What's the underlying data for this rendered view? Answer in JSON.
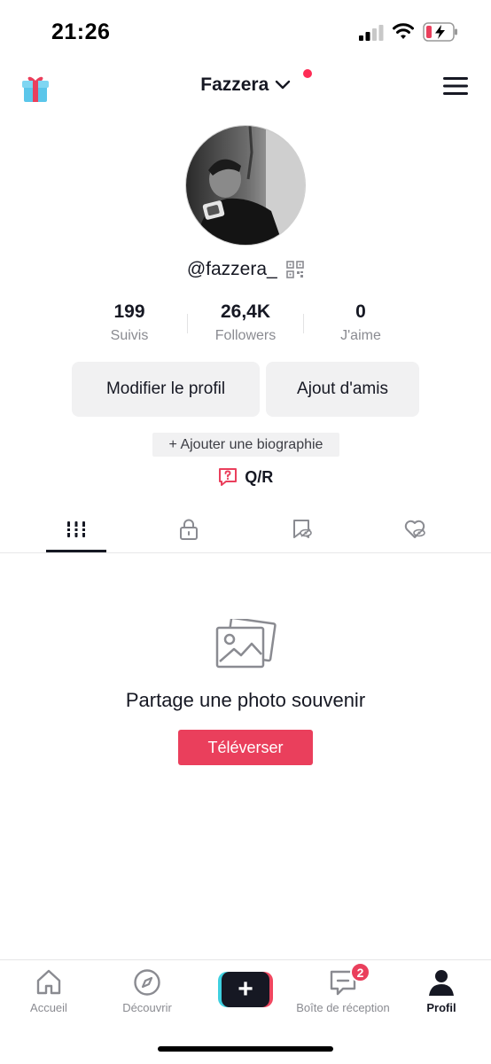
{
  "status_bar": {
    "time": "21:26"
  },
  "header": {
    "account_name": "Fazzera"
  },
  "profile": {
    "username": "@fazzera_",
    "stats": [
      {
        "value": "199",
        "label": "Suivis"
      },
      {
        "value": "26,4K",
        "label": "Followers"
      },
      {
        "value": "0",
        "label": "J'aime"
      }
    ],
    "edit_profile_label": "Modifier le profil",
    "add_friends_label": "Ajout d'amis",
    "add_bio_label": "+ Ajouter une biographie",
    "qa_label": "Q/R"
  },
  "tabs": [
    {
      "icon": "grid-icon",
      "active": true
    },
    {
      "icon": "lock-icon",
      "active": false
    },
    {
      "icon": "hidden-bookmark-icon",
      "active": false
    },
    {
      "icon": "hidden-heart-icon",
      "active": false
    }
  ],
  "empty_state": {
    "icon": "photo-icon",
    "title": "Partage une photo souvenir",
    "upload_label": "Téléverser"
  },
  "bottom_nav": {
    "items": [
      {
        "label": "Accueil",
        "icon": "home-icon"
      },
      {
        "label": "Découvrir",
        "icon": "compass-icon"
      },
      {
        "label": "",
        "icon": "plus-icon"
      },
      {
        "label": "Boîte de réception",
        "icon": "inbox-icon",
        "badge": "2"
      },
      {
        "label": "Profil",
        "icon": "person-icon",
        "active": true
      }
    ]
  },
  "colors": {
    "accent": "#ea3f5c",
    "text": "#161823",
    "muted": "#8a8b91"
  }
}
